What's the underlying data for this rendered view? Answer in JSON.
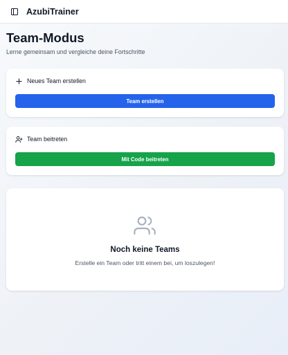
{
  "app": {
    "title": "AzubiTrainer"
  },
  "page": {
    "title": "Team-Modus",
    "subtitle": "Lerne gemeinsam und vergleiche deine Fortschritte"
  },
  "create_card": {
    "heading": "Neues Team erstellen",
    "button_label": "Team erstellen",
    "icon": "plus-icon",
    "button_color": "#2563eb"
  },
  "join_card": {
    "heading": "Team beitreten",
    "button_label": "Mit Code beitreten",
    "icon": "user-plus-icon",
    "button_color": "#16a34a"
  },
  "empty_state": {
    "title": "Noch keine Teams",
    "text": "Erstelle ein Team oder tritt einem bei, um loszulegen!",
    "icon": "users-icon"
  },
  "colors": {
    "primary": "#2563eb",
    "success": "#16a34a",
    "text": "#111827",
    "muted": "#4b5563"
  }
}
